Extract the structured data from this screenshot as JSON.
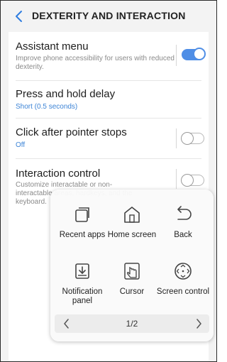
{
  "header": {
    "title": "DEXTERITY AND INTERACTION",
    "back_icon": "chevron-left-icon"
  },
  "settings": [
    {
      "title": "Assistant menu",
      "subtitle": "Improve phone accessibility for users with reduced dexterity.",
      "toggle": "on"
    },
    {
      "title": "Press and hold delay",
      "subtitle": "Short (0.5 seconds)"
    },
    {
      "title": "Click after pointer stops",
      "subtitle": "Off",
      "toggle": "off"
    },
    {
      "title": "Interaction control",
      "subtitle": "Customize interactable or non-interactable areas, hardkeys, and the keyboard.",
      "toggle": "off"
    }
  ],
  "assistant_menu": {
    "items": [
      {
        "label": "Recent apps",
        "icon": "recent-apps-icon"
      },
      {
        "label": "Home screen",
        "icon": "home-icon"
      },
      {
        "label": "Back",
        "icon": "back-arrow-icon"
      },
      {
        "label": "Notification panel",
        "icon": "notification-panel-icon"
      },
      {
        "label": "Cursor",
        "icon": "cursor-hand-icon"
      },
      {
        "label": "Screen control",
        "icon": "screen-control-icon"
      }
    ],
    "page": "1/2"
  },
  "colors": {
    "accent": "#4f8ee6",
    "subtitle_blue": "#3d84d6"
  }
}
